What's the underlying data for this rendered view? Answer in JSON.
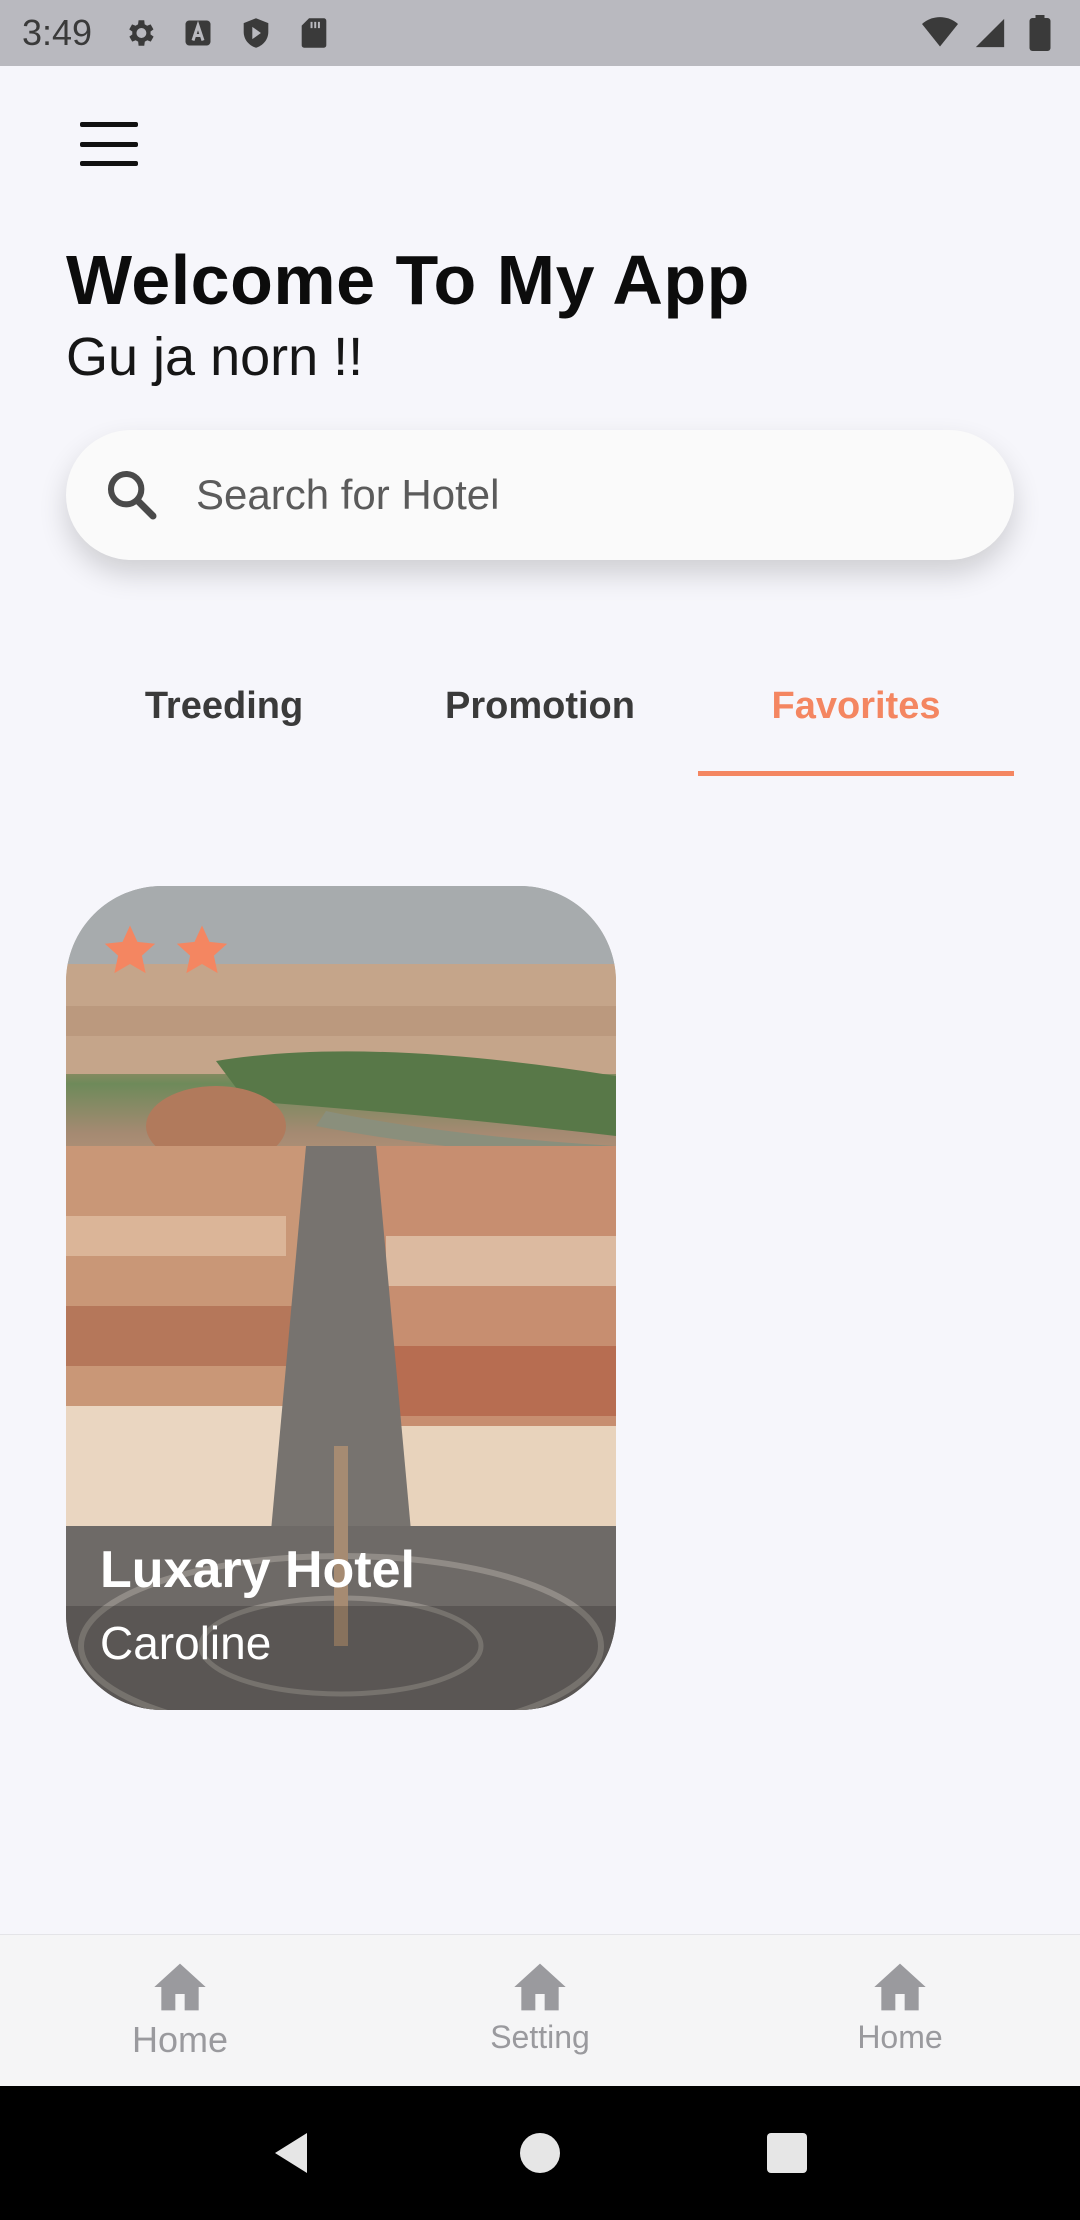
{
  "status_bar": {
    "time": "3:49"
  },
  "header": {
    "title": "Welcome To My App",
    "subtitle": "Gu ja norn !!"
  },
  "search": {
    "placeholder": "Search for Hotel"
  },
  "tabs": [
    {
      "label": "Treeding",
      "active": false
    },
    {
      "label": "Promotion",
      "active": false
    },
    {
      "label": "Favorites",
      "active": true
    }
  ],
  "card": {
    "title": "Luxary Hotel",
    "subtitle": "Caroline",
    "stars": 2
  },
  "bottom_nav": [
    {
      "label": "Home",
      "icon": "home-icon"
    },
    {
      "label": "Setting",
      "icon": "home-icon"
    },
    {
      "label": "Home",
      "icon": "home-icon"
    }
  ],
  "colors": {
    "accent": "#f48661",
    "background": "#f6f6fb",
    "nav_inactive": "#9a9a9e"
  }
}
